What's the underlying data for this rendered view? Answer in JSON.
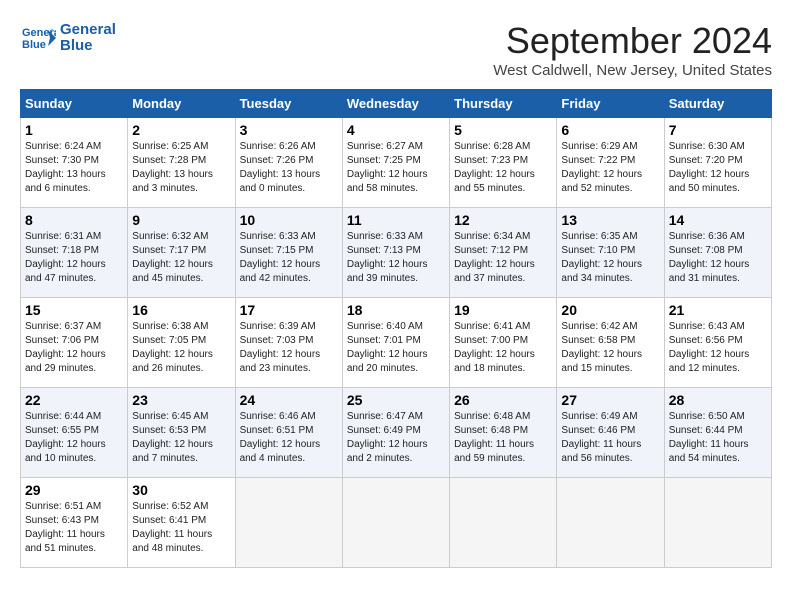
{
  "logo": {
    "line1": "General",
    "line2": "Blue"
  },
  "title": "September 2024",
  "location": "West Caldwell, New Jersey, United States",
  "days_header": [
    "Sunday",
    "Monday",
    "Tuesday",
    "Wednesday",
    "Thursday",
    "Friday",
    "Saturday"
  ],
  "weeks": [
    [
      {
        "num": "1",
        "info": "Sunrise: 6:24 AM\nSunset: 7:30 PM\nDaylight: 13 hours\nand 6 minutes."
      },
      {
        "num": "2",
        "info": "Sunrise: 6:25 AM\nSunset: 7:28 PM\nDaylight: 13 hours\nand 3 minutes."
      },
      {
        "num": "3",
        "info": "Sunrise: 6:26 AM\nSunset: 7:26 PM\nDaylight: 13 hours\nand 0 minutes."
      },
      {
        "num": "4",
        "info": "Sunrise: 6:27 AM\nSunset: 7:25 PM\nDaylight: 12 hours\nand 58 minutes."
      },
      {
        "num": "5",
        "info": "Sunrise: 6:28 AM\nSunset: 7:23 PM\nDaylight: 12 hours\nand 55 minutes."
      },
      {
        "num": "6",
        "info": "Sunrise: 6:29 AM\nSunset: 7:22 PM\nDaylight: 12 hours\nand 52 minutes."
      },
      {
        "num": "7",
        "info": "Sunrise: 6:30 AM\nSunset: 7:20 PM\nDaylight: 12 hours\nand 50 minutes."
      }
    ],
    [
      {
        "num": "8",
        "info": "Sunrise: 6:31 AM\nSunset: 7:18 PM\nDaylight: 12 hours\nand 47 minutes."
      },
      {
        "num": "9",
        "info": "Sunrise: 6:32 AM\nSunset: 7:17 PM\nDaylight: 12 hours\nand 45 minutes."
      },
      {
        "num": "10",
        "info": "Sunrise: 6:33 AM\nSunset: 7:15 PM\nDaylight: 12 hours\nand 42 minutes."
      },
      {
        "num": "11",
        "info": "Sunrise: 6:33 AM\nSunset: 7:13 PM\nDaylight: 12 hours\nand 39 minutes."
      },
      {
        "num": "12",
        "info": "Sunrise: 6:34 AM\nSunset: 7:12 PM\nDaylight: 12 hours\nand 37 minutes."
      },
      {
        "num": "13",
        "info": "Sunrise: 6:35 AM\nSunset: 7:10 PM\nDaylight: 12 hours\nand 34 minutes."
      },
      {
        "num": "14",
        "info": "Sunrise: 6:36 AM\nSunset: 7:08 PM\nDaylight: 12 hours\nand 31 minutes."
      }
    ],
    [
      {
        "num": "15",
        "info": "Sunrise: 6:37 AM\nSunset: 7:06 PM\nDaylight: 12 hours\nand 29 minutes."
      },
      {
        "num": "16",
        "info": "Sunrise: 6:38 AM\nSunset: 7:05 PM\nDaylight: 12 hours\nand 26 minutes."
      },
      {
        "num": "17",
        "info": "Sunrise: 6:39 AM\nSunset: 7:03 PM\nDaylight: 12 hours\nand 23 minutes."
      },
      {
        "num": "18",
        "info": "Sunrise: 6:40 AM\nSunset: 7:01 PM\nDaylight: 12 hours\nand 20 minutes."
      },
      {
        "num": "19",
        "info": "Sunrise: 6:41 AM\nSunset: 7:00 PM\nDaylight: 12 hours\nand 18 minutes."
      },
      {
        "num": "20",
        "info": "Sunrise: 6:42 AM\nSunset: 6:58 PM\nDaylight: 12 hours\nand 15 minutes."
      },
      {
        "num": "21",
        "info": "Sunrise: 6:43 AM\nSunset: 6:56 PM\nDaylight: 12 hours\nand 12 minutes."
      }
    ],
    [
      {
        "num": "22",
        "info": "Sunrise: 6:44 AM\nSunset: 6:55 PM\nDaylight: 12 hours\nand 10 minutes."
      },
      {
        "num": "23",
        "info": "Sunrise: 6:45 AM\nSunset: 6:53 PM\nDaylight: 12 hours\nand 7 minutes."
      },
      {
        "num": "24",
        "info": "Sunrise: 6:46 AM\nSunset: 6:51 PM\nDaylight: 12 hours\nand 4 minutes."
      },
      {
        "num": "25",
        "info": "Sunrise: 6:47 AM\nSunset: 6:49 PM\nDaylight: 12 hours\nand 2 minutes."
      },
      {
        "num": "26",
        "info": "Sunrise: 6:48 AM\nSunset: 6:48 PM\nDaylight: 11 hours\nand 59 minutes."
      },
      {
        "num": "27",
        "info": "Sunrise: 6:49 AM\nSunset: 6:46 PM\nDaylight: 11 hours\nand 56 minutes."
      },
      {
        "num": "28",
        "info": "Sunrise: 6:50 AM\nSunset: 6:44 PM\nDaylight: 11 hours\nand 54 minutes."
      }
    ],
    [
      {
        "num": "29",
        "info": "Sunrise: 6:51 AM\nSunset: 6:43 PM\nDaylight: 11 hours\nand 51 minutes."
      },
      {
        "num": "30",
        "info": "Sunrise: 6:52 AM\nSunset: 6:41 PM\nDaylight: 11 hours\nand 48 minutes."
      },
      {
        "num": "",
        "info": ""
      },
      {
        "num": "",
        "info": ""
      },
      {
        "num": "",
        "info": ""
      },
      {
        "num": "",
        "info": ""
      },
      {
        "num": "",
        "info": ""
      }
    ]
  ]
}
